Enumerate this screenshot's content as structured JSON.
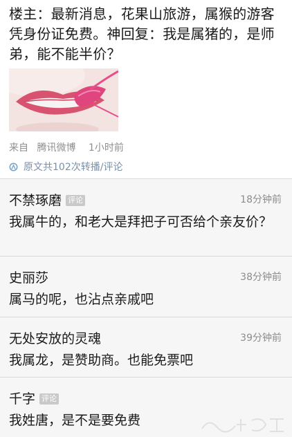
{
  "post": {
    "text": "楼主：最新消息，花果山旅游，属猴的游客凭身份证免费。神回复：我是属猪的，是师弟，能不能半价？",
    "image_icon": "lips-photo",
    "from_label": "来自",
    "from_app": "腾讯微博",
    "time": "1小时前",
    "repost_text": "原文共102次转播/评论",
    "repost_icon": "weibo-logo-icon"
  },
  "comments": [
    {
      "name": "不禁琢磨",
      "tag": "评论",
      "time": "18分钟前",
      "text": "我属牛的，和老大是拜把子可否给个亲友价？"
    },
    {
      "name": "史丽莎",
      "tag": "",
      "time": "38分钟前",
      "text": "属马的呢，也沾点亲戚吧"
    },
    {
      "name": "无处安放的灵魂",
      "tag": "",
      "time": "39分钟前",
      "text": "我属龙，是赞助商。也能免票吧"
    },
    {
      "name": "千字",
      "tag": "评论",
      "time": "",
      "text": "我姓唐，是不是要免费"
    }
  ],
  "colors": {
    "link": "#7a8fa8",
    "meta": "#8f8f8f",
    "comment_bg": "#f6f6f6",
    "tag_bg": "#c9c9c9"
  }
}
